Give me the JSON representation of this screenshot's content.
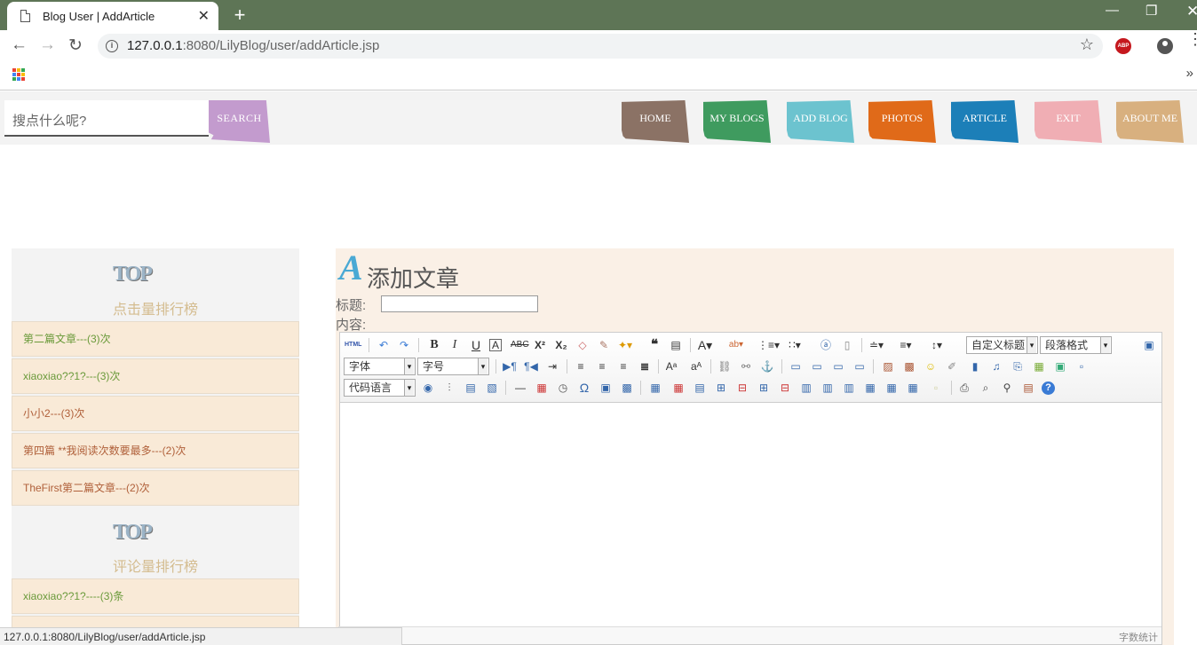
{
  "browser": {
    "tab_title": "Blog User | AddArticle",
    "url_host": "127.0.0.1",
    "url_path": ":8080/LilyBlog/user/addArticle.jsp",
    "abp_label": "ABP"
  },
  "header": {
    "search_placeholder": "搜点什么呢?",
    "search_button": "SEARCH",
    "nav": [
      {
        "label": "HOME",
        "color": "#8b7265"
      },
      {
        "label": "MY BLOGS",
        "color": "#3f9b5f"
      },
      {
        "label": "ADD BLOG",
        "color": "#6cc3cf"
      },
      {
        "label": "PHOTOS",
        "color": "#e06a19"
      },
      {
        "label": "ARTICLE",
        "color": "#1c7fb8"
      },
      {
        "label": "EXIT",
        "color": "#f0aeb4"
      },
      {
        "label": "ABOUT ME",
        "color": "#d8b07f"
      }
    ]
  },
  "sidebar": {
    "top_img_text": "TOP",
    "click_rank_title": "点击量排行榜",
    "click_rank": [
      {
        "text": "第二篇文章---(3)次",
        "color": "#6a9a3a"
      },
      {
        "text": "xiaoxiao??1?---(3)次",
        "color": "#6a9a3a"
      },
      {
        "text": "小小2---(3)次",
        "color": "#b0603a"
      },
      {
        "text": "第四篇 **我阅读次数要最多---(2)次",
        "color": "#b0603a"
      },
      {
        "text": "TheFirst第二篇文章---(2)次",
        "color": "#b0603a"
      }
    ],
    "comment_rank_title": "评论量排行榜",
    "comment_rank": [
      {
        "text": "xiaoxiao??1?----(3)条",
        "color": "#6a9a3a"
      }
    ]
  },
  "main": {
    "logo_letter": "A",
    "title": "添加文章",
    "title_label": "标题:",
    "title_value": "",
    "content_label": "内容:",
    "toolbar": {
      "html_label": "HTML",
      "custom_heading": "自定义标题",
      "paragraph_format": "段落格式",
      "font_family": "字体",
      "font_size": "字号",
      "code_language": "代码语言"
    },
    "word_count": "字数统计"
  },
  "status_bar": "127.0.0.1:8080/LilyBlog/user/addArticle.jsp"
}
